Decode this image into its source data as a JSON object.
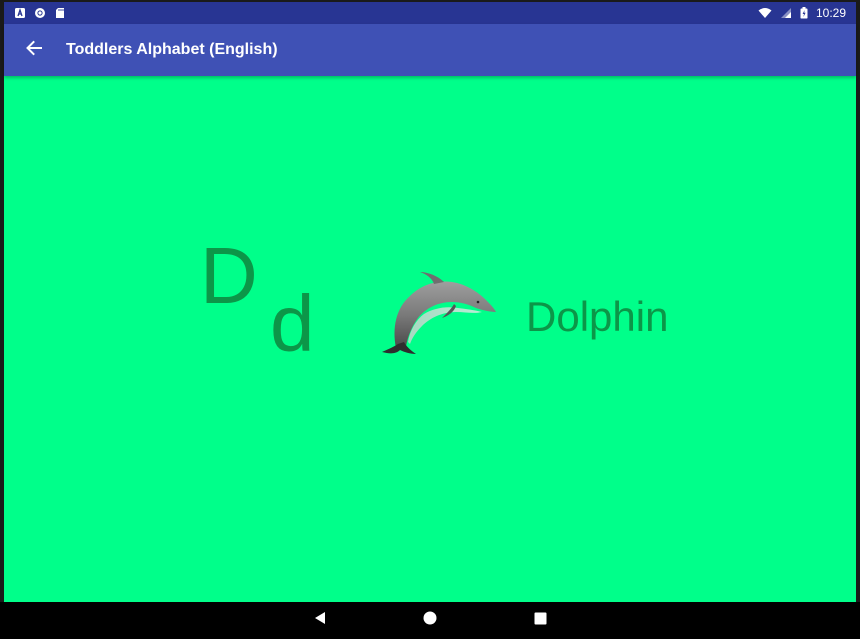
{
  "status_bar": {
    "time": "10:29",
    "left_icons": [
      "notification-a-icon",
      "circle-sync-icon",
      "sd-card-icon"
    ],
    "right_icons": [
      "wifi-icon",
      "signal-icon",
      "battery-icon"
    ]
  },
  "app_bar": {
    "title": "Toddlers Alphabet (English)",
    "back_icon": "arrow-back-icon",
    "color": "#3f51b5"
  },
  "content": {
    "background_color": "#00ff8a",
    "text_color": "#0c9648",
    "uppercase_letter": "D",
    "lowercase_letter": "d",
    "image": "dolphin",
    "word": "Dolphin"
  },
  "nav_bar": {
    "buttons": [
      "back-triangle-icon",
      "home-circle-icon",
      "recents-square-icon"
    ]
  }
}
